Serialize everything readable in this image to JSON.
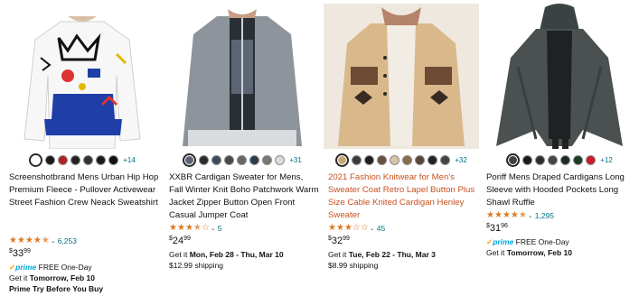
{
  "products": [
    {
      "title": "Screenshotbrand Mens Urban Hip Hop Premium Fleece - Pullover Activewear Street Fashion Crew Neack Sweatshirt",
      "title_color": "#0f1111",
      "swatch_colors": [
        "#ffffff",
        "#1a1a1a",
        "#b22222",
        "#222222",
        "#333333",
        "#1a1a1a",
        "#111111"
      ],
      "more_colors": "+14",
      "rating_stars": 4.5,
      "rating_count": "6,253",
      "price": {
        "symbol": "$",
        "whole": "33",
        "fraction": "99"
      },
      "lines": [
        {
          "prime": true,
          "prime_label": "prime",
          "rest": " FREE One-Day"
        },
        {
          "pre": "Get it ",
          "bold": "Tomorrow, Feb 10",
          "post": ""
        },
        {
          "pre": "",
          "bold": "Prime Try Before You Buy",
          "post": ""
        }
      ]
    },
    {
      "title": "XXBR Cardigan Sweater for Mens, Fall Winter Knit Boho Patchwork Warm Jacket Zipper Button Open Front Casual Jumper Coat",
      "title_color": "#0f1111",
      "swatch_colors": [
        "#5d6670",
        "#2b2b2b",
        "#3c4a5a",
        "#4a4a4a",
        "#666666",
        "#2c3a4c",
        "#777777",
        "#dcdcdc"
      ],
      "more_colors": "+31",
      "rating_stars": 3.5,
      "rating_count": "5",
      "price": {
        "symbol": "$",
        "whole": "24",
        "fraction": "99"
      },
      "lines": [
        {
          "pre": "Get it ",
          "bold": "Mon, Feb 28 - Thu, Mar 10",
          "post": ""
        },
        {
          "pre": "$12.99 shipping",
          "bold": "",
          "post": ""
        }
      ]
    },
    {
      "title": "2021 Fashion Knitwear for Men's Sweater Coat Retro Lapel Button Plus Size Cable Knited Cardigan Henley Sweater",
      "title_color": "#c7511f",
      "swatch_colors": [
        "#c9a57a",
        "#3a3a3a",
        "#1f1f1f",
        "#6b4f3a",
        "#d8c3a5",
        "#8a6b4a",
        "#5a4636",
        "#222222",
        "#444444"
      ],
      "more_colors": "+32",
      "rating_stars": 3,
      "rating_count": "45",
      "price": {
        "symbol": "$",
        "whole": "32",
        "fraction": "99"
      },
      "lines": [
        {
          "pre": "Get it ",
          "bold": "Tue, Feb 22 - Thu, Mar 3",
          "post": ""
        },
        {
          "pre": "$8.99 shipping",
          "bold": "",
          "post": ""
        }
      ]
    },
    {
      "title": "Poriff Mens Draped Cardigans Long Sleeve with Hooded Pockets Long Shawl Ruffle",
      "title_color": "#0f1111",
      "swatch_colors": [
        "#3d4544",
        "#1a1a1a",
        "#2d2d2d",
        "#444444",
        "#1e2a22",
        "#1c3b2a",
        "#c81a2b"
      ],
      "more_colors": "+12",
      "rating_stars": 4.5,
      "rating_count": "1,295",
      "price": {
        "symbol": "$",
        "whole": "31",
        "fraction": "96"
      },
      "lines": [
        {
          "prime": true,
          "prime_label": "prime",
          "rest": " FREE One-Day"
        },
        {
          "pre": "Get it ",
          "bold": "Tomorrow, Feb 10",
          "post": ""
        }
      ]
    }
  ]
}
